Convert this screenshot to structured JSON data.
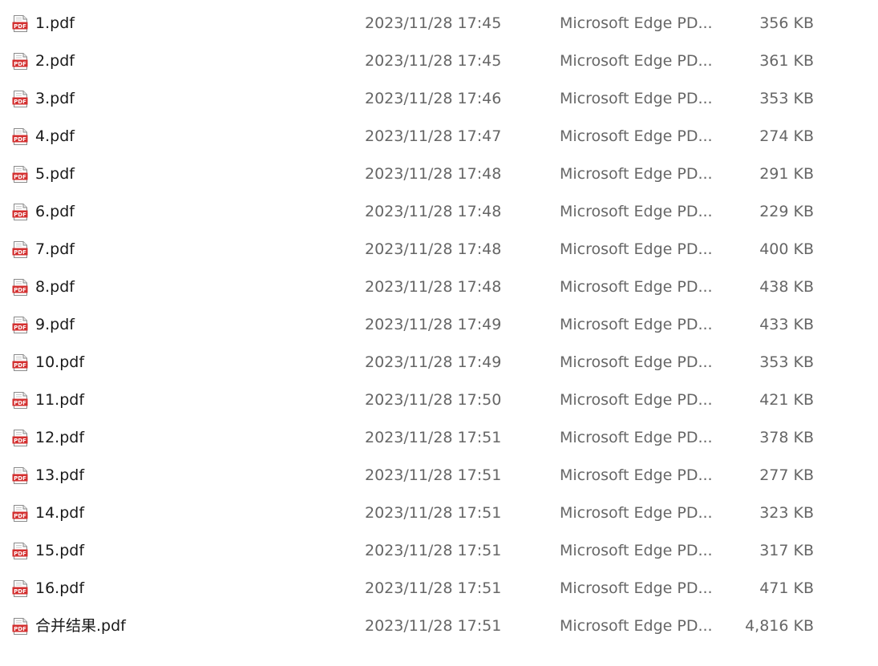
{
  "files": [
    {
      "name": "1.pdf",
      "date": "2023/11/28 17:45",
      "type": "Microsoft Edge PD...",
      "size": "356 KB",
      "icon": "pdf-file-icon"
    },
    {
      "name": "2.pdf",
      "date": "2023/11/28 17:45",
      "type": "Microsoft Edge PD...",
      "size": "361 KB",
      "icon": "pdf-file-icon"
    },
    {
      "name": "3.pdf",
      "date": "2023/11/28 17:46",
      "type": "Microsoft Edge PD...",
      "size": "353 KB",
      "icon": "pdf-file-icon"
    },
    {
      "name": "4.pdf",
      "date": "2023/11/28 17:47",
      "type": "Microsoft Edge PD...",
      "size": "274 KB",
      "icon": "pdf-file-icon"
    },
    {
      "name": "5.pdf",
      "date": "2023/11/28 17:48",
      "type": "Microsoft Edge PD...",
      "size": "291 KB",
      "icon": "pdf-file-icon"
    },
    {
      "name": "6.pdf",
      "date": "2023/11/28 17:48",
      "type": "Microsoft Edge PD...",
      "size": "229 KB",
      "icon": "pdf-file-icon"
    },
    {
      "name": "7.pdf",
      "date": "2023/11/28 17:48",
      "type": "Microsoft Edge PD...",
      "size": "400 KB",
      "icon": "pdf-file-icon"
    },
    {
      "name": "8.pdf",
      "date": "2023/11/28 17:48",
      "type": "Microsoft Edge PD...",
      "size": "438 KB",
      "icon": "pdf-file-icon"
    },
    {
      "name": "9.pdf",
      "date": "2023/11/28 17:49",
      "type": "Microsoft Edge PD...",
      "size": "433 KB",
      "icon": "pdf-file-icon"
    },
    {
      "name": "10.pdf",
      "date": "2023/11/28 17:49",
      "type": "Microsoft Edge PD...",
      "size": "353 KB",
      "icon": "pdf-file-icon"
    },
    {
      "name": "11.pdf",
      "date": "2023/11/28 17:50",
      "type": "Microsoft Edge PD...",
      "size": "421 KB",
      "icon": "pdf-file-icon"
    },
    {
      "name": "12.pdf",
      "date": "2023/11/28 17:51",
      "type": "Microsoft Edge PD...",
      "size": "378 KB",
      "icon": "pdf-file-icon"
    },
    {
      "name": "13.pdf",
      "date": "2023/11/28 17:51",
      "type": "Microsoft Edge PD...",
      "size": "277 KB",
      "icon": "pdf-file-icon"
    },
    {
      "name": "14.pdf",
      "date": "2023/11/28 17:51",
      "type": "Microsoft Edge PD...",
      "size": "323 KB",
      "icon": "pdf-file-icon"
    },
    {
      "name": "15.pdf",
      "date": "2023/11/28 17:51",
      "type": "Microsoft Edge PD...",
      "size": "317 KB",
      "icon": "pdf-file-icon"
    },
    {
      "name": "16.pdf",
      "date": "2023/11/28 17:51",
      "type": "Microsoft Edge PD...",
      "size": "471 KB",
      "icon": "pdf-file-icon"
    },
    {
      "name": "合并结果.pdf",
      "date": "2023/11/28 17:51",
      "type": "Microsoft Edge PD...",
      "size": "4,816 KB",
      "icon": "pdf-file-icon"
    }
  ],
  "colors": {
    "pdf_red": "#d32f2f",
    "name_text": "#1a1a1a",
    "detail_text": "#666666"
  }
}
